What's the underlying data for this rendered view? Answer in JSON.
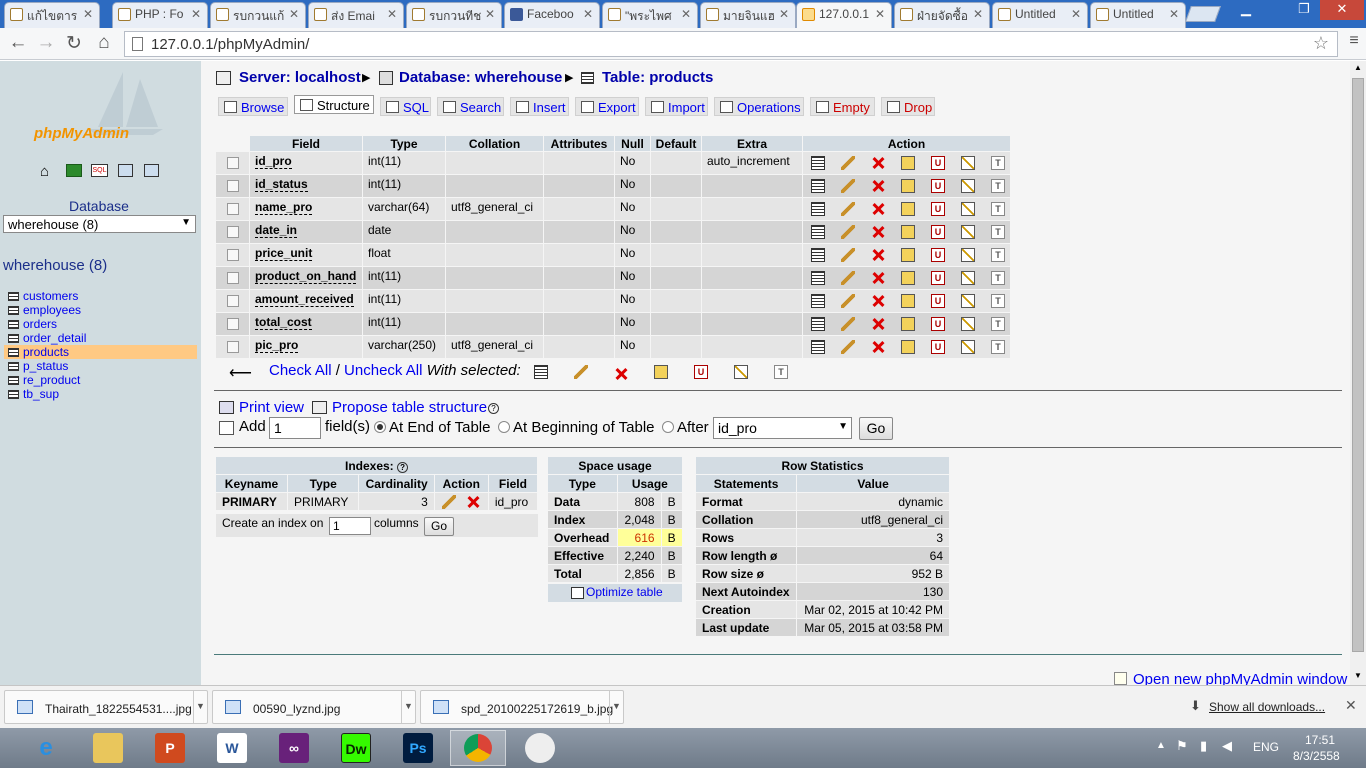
{
  "browser": {
    "tabs": [
      {
        "label": "แก้ไขตาร"
      },
      {
        "label": "PHP : Fo"
      },
      {
        "label": "รบกวนแก้"
      },
      {
        "label": "ส่ง Emai"
      },
      {
        "label": "รบกวนทีช"
      },
      {
        "label": "Faceboo"
      },
      {
        "label": "\"พระไพศ"
      },
      {
        "label": "มายจินแฮ"
      },
      {
        "label": "127.0.0.1"
      },
      {
        "label": "ฝ่ายจัดซื้อ"
      },
      {
        "label": "Untitled"
      },
      {
        "label": "Untitled"
      }
    ],
    "url": "127.0.0.1/phpMyAdmin/"
  },
  "sidebar": {
    "logo_text": "phpMyAdmin",
    "database_label": "Database",
    "db_select": "wherehouse (8)",
    "db_heading": "wherehouse (8)",
    "tables": [
      "customers",
      "employees",
      "orders",
      "order_detail",
      "products",
      "p_status",
      "re_product",
      "tb_sup"
    ],
    "active_table": "products"
  },
  "breadcrumb": {
    "server": "Server: localhost",
    "database": "Database: wherehouse",
    "table": "Table: products"
  },
  "tabs": [
    "Browse",
    "Structure",
    "SQL",
    "Search",
    "Insert",
    "Export",
    "Import",
    "Operations",
    "Empty",
    "Drop"
  ],
  "structure": {
    "headers": [
      "Field",
      "Type",
      "Collation",
      "Attributes",
      "Null",
      "Default",
      "Extra",
      "Action"
    ],
    "rows": [
      {
        "field": "id_pro",
        "type": "int(11)",
        "collation": "",
        "attributes": "",
        "null": "No",
        "default": "",
        "extra": "auto_increment"
      },
      {
        "field": "id_status",
        "type": "int(11)",
        "collation": "",
        "attributes": "",
        "null": "No",
        "default": "",
        "extra": ""
      },
      {
        "field": "name_pro",
        "type": "varchar(64)",
        "collation": "utf8_general_ci",
        "attributes": "",
        "null": "No",
        "default": "",
        "extra": ""
      },
      {
        "field": "date_in",
        "type": "date",
        "collation": "",
        "attributes": "",
        "null": "No",
        "default": "",
        "extra": ""
      },
      {
        "field": "price_unit",
        "type": "float",
        "collation": "",
        "attributes": "",
        "null": "No",
        "default": "",
        "extra": ""
      },
      {
        "field": "product_on_hand",
        "type": "int(11)",
        "collation": "",
        "attributes": "",
        "null": "No",
        "default": "",
        "extra": ""
      },
      {
        "field": "amount_received",
        "type": "int(11)",
        "collation": "",
        "attributes": "",
        "null": "No",
        "default": "",
        "extra": ""
      },
      {
        "field": "total_cost",
        "type": "int(11)",
        "collation": "",
        "attributes": "",
        "null": "No",
        "default": "",
        "extra": ""
      },
      {
        "field": "pic_pro",
        "type": "varchar(250)",
        "collation": "utf8_general_ci",
        "attributes": "",
        "null": "No",
        "default": "",
        "extra": ""
      }
    ],
    "check_all": "Check All",
    "uncheck_all": "Uncheck All",
    "separator": "/",
    "with_selected": "With selected:"
  },
  "actions": {
    "print_view": "Print view",
    "propose": "Propose table structure",
    "add_label": "Add",
    "add_value": "1",
    "fields_label": "field(s)",
    "at_end": "At End of Table",
    "at_beginning": "At Beginning of Table",
    "after": "After",
    "after_select": "id_pro",
    "go": "Go"
  },
  "indexes": {
    "title": "Indexes:",
    "headers": [
      "Keyname",
      "Type",
      "Cardinality",
      "Action",
      "Field"
    ],
    "row": {
      "keyname": "PRIMARY",
      "type": "PRIMARY",
      "cardinality": "3",
      "field": "id_pro"
    },
    "create_label": "Create an index on",
    "create_value": "1",
    "columns_label": "columns",
    "go": "Go"
  },
  "space": {
    "title": "Space usage",
    "headers": [
      "Type",
      "Usage"
    ],
    "rows": [
      {
        "type": "Data",
        "usage": "808",
        "unit": "B"
      },
      {
        "type": "Index",
        "usage": "2,048",
        "unit": "B"
      },
      {
        "type": "Overhead",
        "usage": "616",
        "unit": "B"
      },
      {
        "type": "Effective",
        "usage": "2,240",
        "unit": "B"
      },
      {
        "type": "Total",
        "usage": "2,856",
        "unit": "B"
      }
    ],
    "optimize": "Optimize table"
  },
  "rowstats": {
    "title": "Row Statistics",
    "headers": [
      "Statements",
      "Value"
    ],
    "rows": [
      {
        "k": "Format",
        "v": "dynamic"
      },
      {
        "k": "Collation",
        "v": "utf8_general_ci"
      },
      {
        "k": "Rows",
        "v": "3"
      },
      {
        "k": "Row length ø",
        "v": "64"
      },
      {
        "k": "Row size ø",
        "v": "952 B"
      },
      {
        "k": "Next Autoindex",
        "v": "130"
      },
      {
        "k": "Creation",
        "v": "Mar 02, 2015 at 10:42 PM"
      },
      {
        "k": "Last update",
        "v": "Mar 05, 2015 at 03:58 PM"
      }
    ]
  },
  "footer_link": "Open new phpMyAdmin window",
  "downloads": {
    "items": [
      "Thairath_1822554531....jpg",
      "00590_lyznd.jpg",
      "spd_20100225172619_b.jpg"
    ],
    "show_all": "Show all downloads..."
  },
  "taskbar": {
    "lang": "ENG",
    "time": "17:51",
    "date": "8/3/2558"
  }
}
